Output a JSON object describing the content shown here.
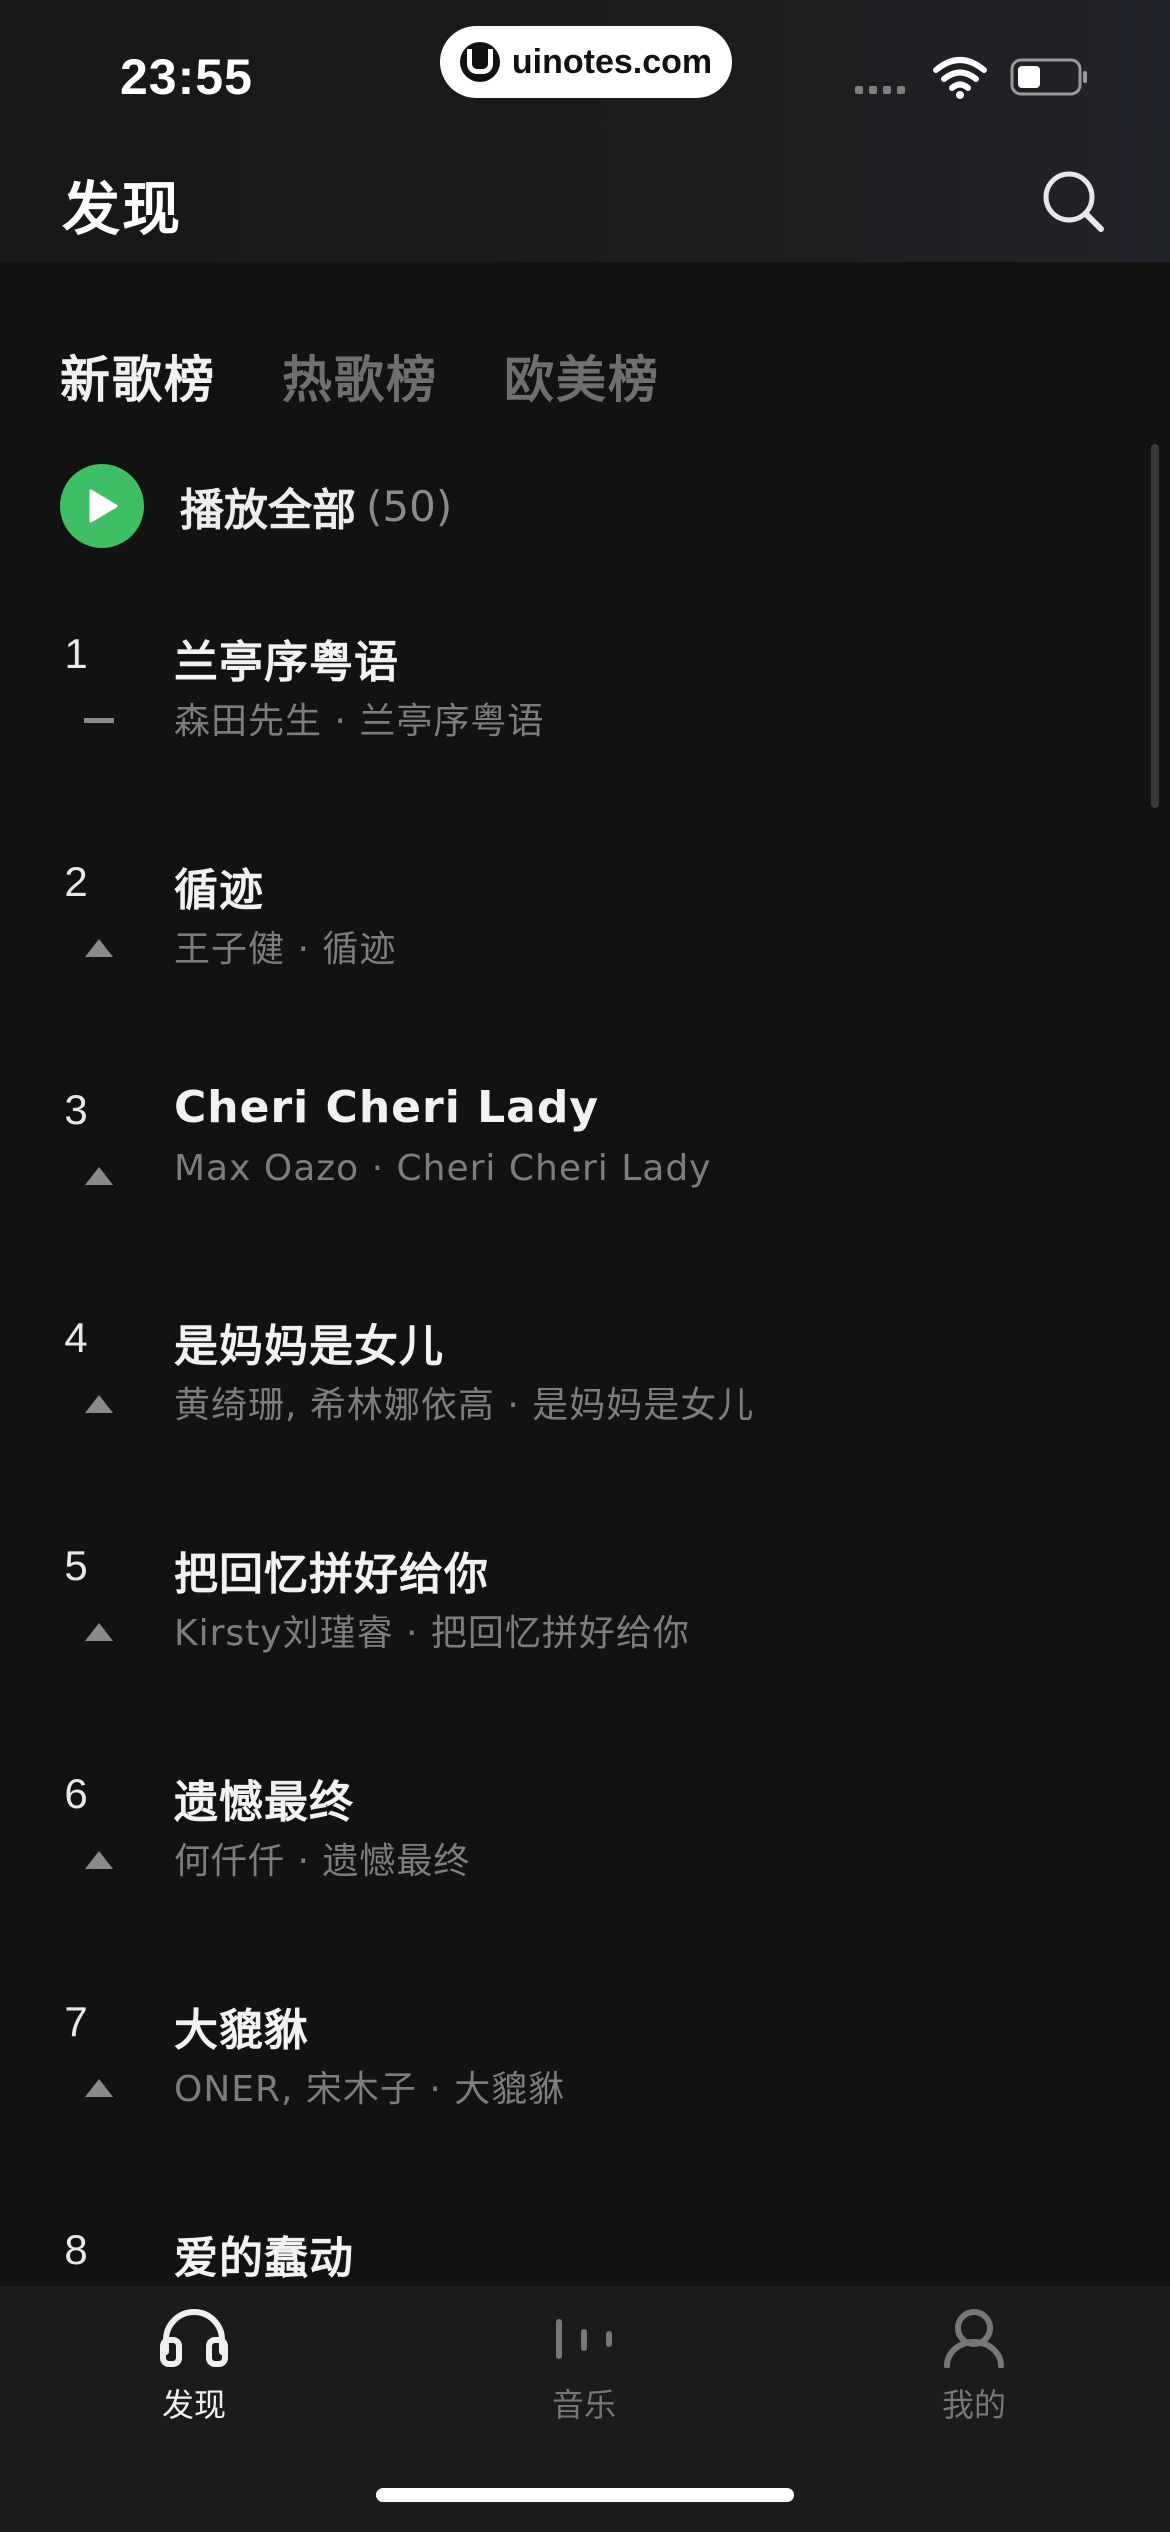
{
  "status_bar": {
    "time": "23:55",
    "site_pill": "uinotes.com"
  },
  "header": {
    "title": "发现",
    "search_icon": "search-icon"
  },
  "tabs": [
    {
      "label": "新歌榜",
      "active": true
    },
    {
      "label": "热歌榜",
      "active": false
    },
    {
      "label": "欧美榜",
      "active": false
    }
  ],
  "play_all": {
    "label": "播放全部",
    "count": "(50)",
    "accent_color": "#3fbf63"
  },
  "songs": [
    {
      "rank": "1",
      "title": "兰亭序粤语",
      "subtitle": "森田先生 · 兰亭序粤语",
      "trend": "flat"
    },
    {
      "rank": "2",
      "title": "循迹",
      "subtitle": "王子健 · 循迹",
      "trend": "up"
    },
    {
      "rank": "3",
      "title": "Cheri Cheri Lady",
      "subtitle": "Max Oazo · Cheri Cheri Lady",
      "trend": "up"
    },
    {
      "rank": "4",
      "title": "是妈妈是女儿",
      "subtitle": "黄绮珊, 希林娜依高 · 是妈妈是女儿",
      "trend": "up"
    },
    {
      "rank": "5",
      "title": "把回忆拼好给你",
      "subtitle": "Kirsty刘瑾睿 · 把回忆拼好给你",
      "trend": "up"
    },
    {
      "rank": "6",
      "title": "遗憾最终",
      "subtitle": "何仟仟 · 遗憾最终",
      "trend": "up"
    },
    {
      "rank": "7",
      "title": "大貔貅",
      "subtitle": "ONER, 宋木子 · 大貔貅",
      "trend": "up"
    },
    {
      "rank": "8",
      "title": "爱的蠢动",
      "subtitle": "",
      "trend": "none"
    }
  ],
  "bottom_nav": [
    {
      "label": "发现",
      "icon": "headphones-icon",
      "active": true
    },
    {
      "label": "音乐",
      "icon": "equalizer-icon",
      "active": false
    },
    {
      "label": "我的",
      "icon": "user-icon",
      "active": false
    }
  ]
}
